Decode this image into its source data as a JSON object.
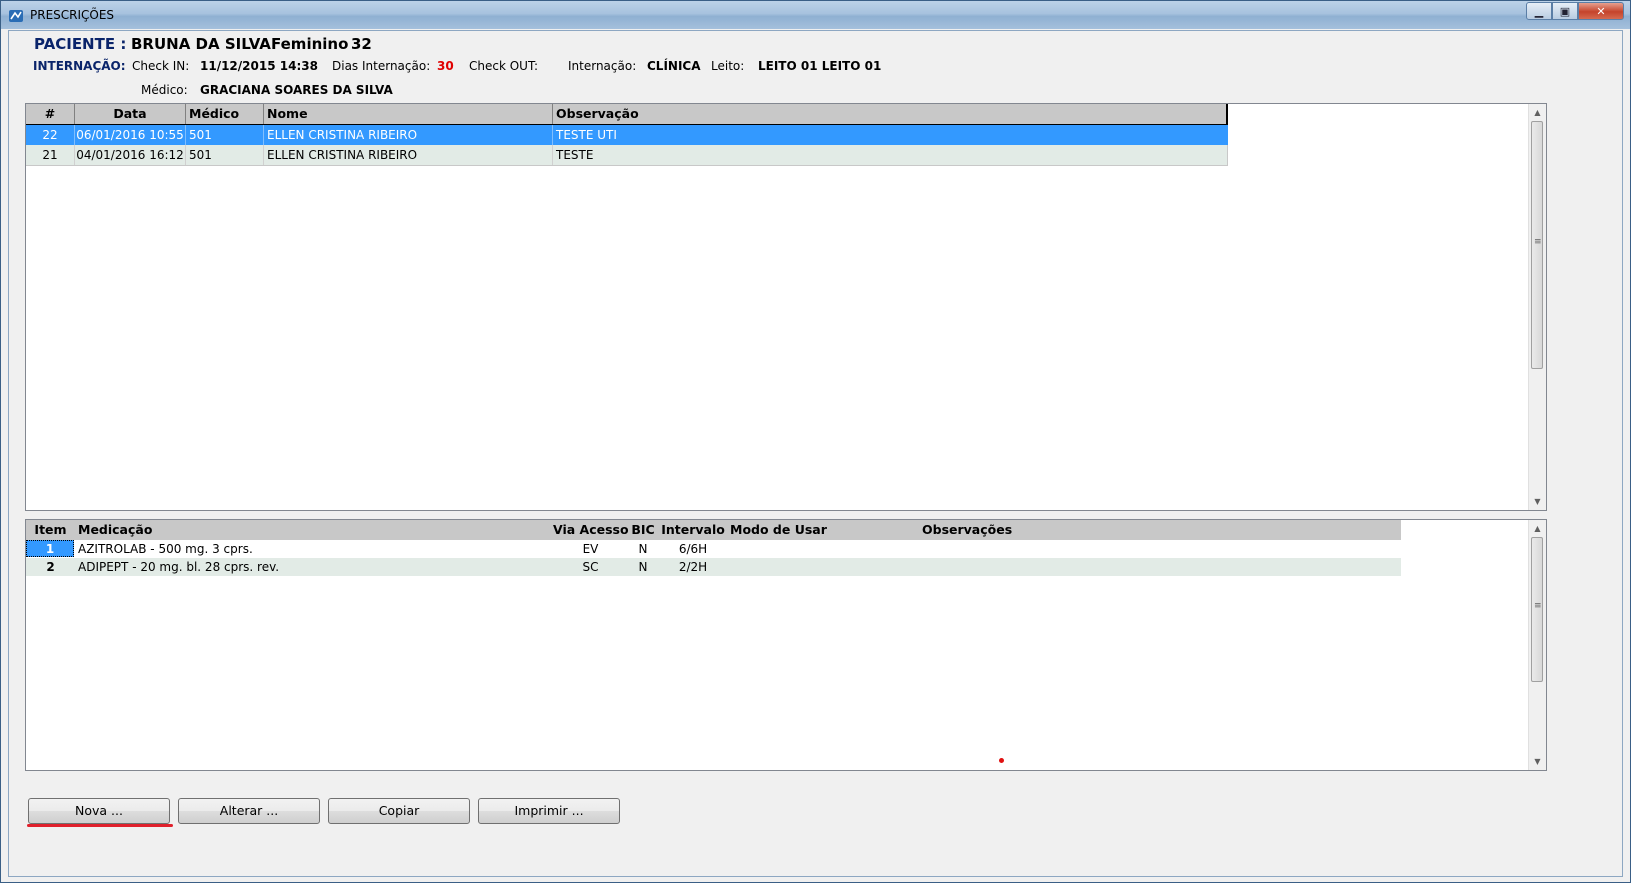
{
  "window": {
    "title": "PRESCRIÇÕES",
    "minimize_icon": "minimize-icon",
    "maximize_icon": "maximize-icon",
    "close_icon": "close-icon"
  },
  "patient": {
    "label": "PACIENTE :",
    "name": "BRUNA DA SILVA",
    "sex": "Feminino",
    "age": "32"
  },
  "admission": {
    "label": "INTERNAÇÃO:",
    "checkin_label": "Check IN:",
    "checkin_value": "11/12/2015 14:38",
    "days_label": "Dias Internação:",
    "days_value": "30",
    "checkout_label": "Check OUT:",
    "checkout_value": "",
    "type_label": "Internação:",
    "type_value": "CLÍNICA",
    "bed_label": "Leito:",
    "bed_value": "LEITO 01 LEITO 01",
    "doctor_label": "Médico:",
    "doctor_value": "GRACIANA SOARES DA SILVA"
  },
  "prescriptions": {
    "columns": [
      "#",
      "Data",
      "Médico",
      "Nome",
      "Observação"
    ],
    "rows": [
      [
        "22",
        "06/01/2016 10:55",
        "501",
        "ELLEN CRISTINA RIBEIRO",
        "TESTE UTI"
      ],
      [
        "21",
        "04/01/2016 16:12",
        "501",
        "ELLEN CRISTINA RIBEIRO",
        "TESTE"
      ]
    ]
  },
  "medications": {
    "columns": [
      "Item",
      "Medicação",
      "Via Acesso",
      "BIC",
      "Intervalo",
      "Modo de Usar",
      "Observações"
    ],
    "rows": [
      [
        "1",
        "AZITROLAB - 500 mg. 3 cprs.",
        "EV",
        "N",
        "6/6H",
        "",
        ""
      ],
      [
        "2",
        "ADIPEPT - 20 mg. bl. 28 cprs. rev.",
        "SC",
        "N",
        "2/2H",
        "",
        ""
      ]
    ]
  },
  "buttons": {
    "nova": "Nova ...",
    "alterar": "Alterar ...",
    "copiar": "Copiar",
    "imprimir": "Imprimir ..."
  },
  "colors": {
    "selection": "#3399ff",
    "alt_row": "#e2ebe6",
    "accent_red": "#e00000",
    "navy_label": "#0a246a"
  }
}
